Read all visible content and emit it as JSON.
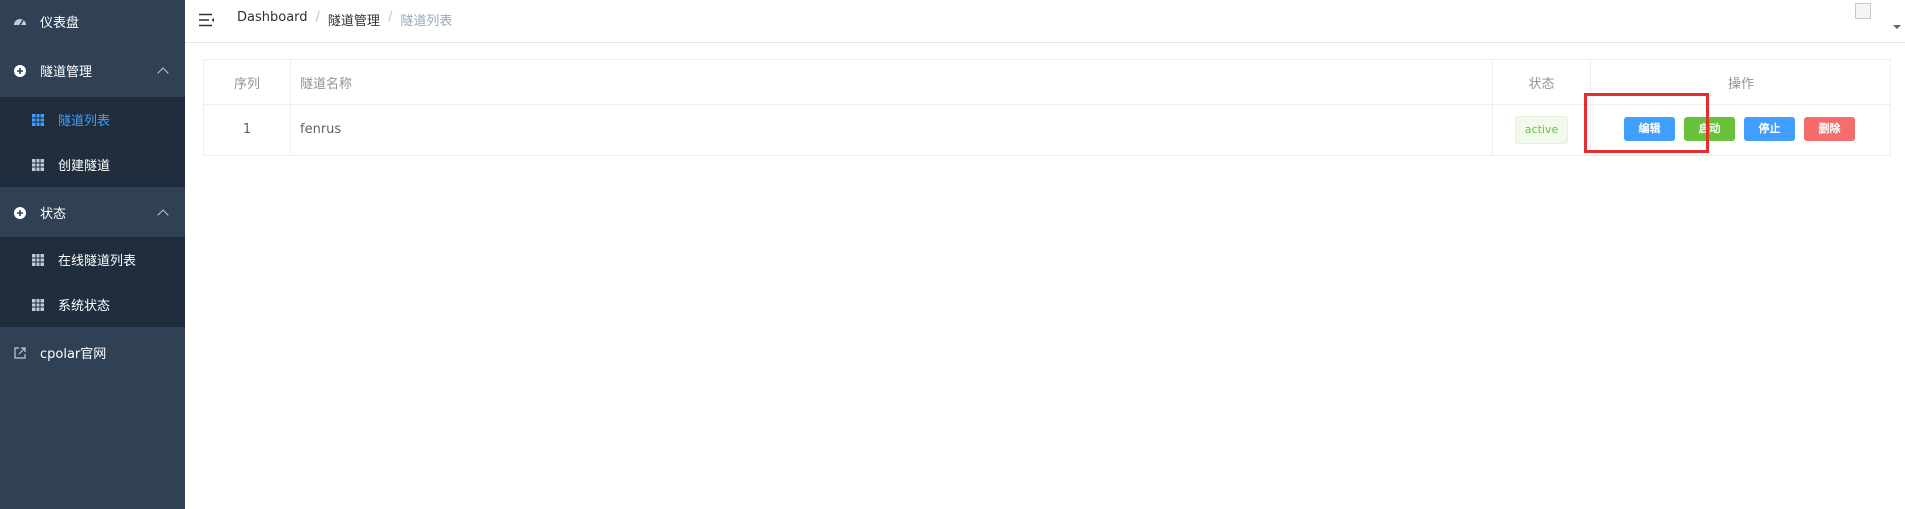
{
  "sidebar": {
    "items": [
      {
        "label": "仪表盘",
        "icon": "dashboard-icon"
      },
      {
        "label": "隧道管理",
        "icon": "plus-circle-icon"
      },
      {
        "label": "隧道列表",
        "icon": "grid-icon"
      },
      {
        "label": "创建隧道",
        "icon": "grid-icon"
      },
      {
        "label": "状态",
        "icon": "plus-circle-icon"
      },
      {
        "label": "在线隧道列表",
        "icon": "grid-icon"
      },
      {
        "label": "系统状态",
        "icon": "grid-icon"
      },
      {
        "label": "cpolar官网",
        "icon": "external-link-icon"
      }
    ]
  },
  "header": {
    "breadcrumb": [
      "Dashboard",
      "隧道管理",
      "隧道列表"
    ]
  },
  "table": {
    "columns": [
      "序列",
      "隧道名称",
      "状态",
      "操作"
    ],
    "rows": [
      {
        "index": "1",
        "name": "fenrus",
        "status": "active"
      }
    ],
    "actions": [
      "编辑",
      "启动",
      "停止",
      "删除"
    ]
  },
  "colors": {
    "sidebar_bg": "#304156",
    "submenu_bg": "#1f2d3d",
    "active_text": "#409eff",
    "primary": "#409eff",
    "success": "#67c23a",
    "danger": "#f56c6c",
    "highlight_box": "#e62e2e"
  }
}
